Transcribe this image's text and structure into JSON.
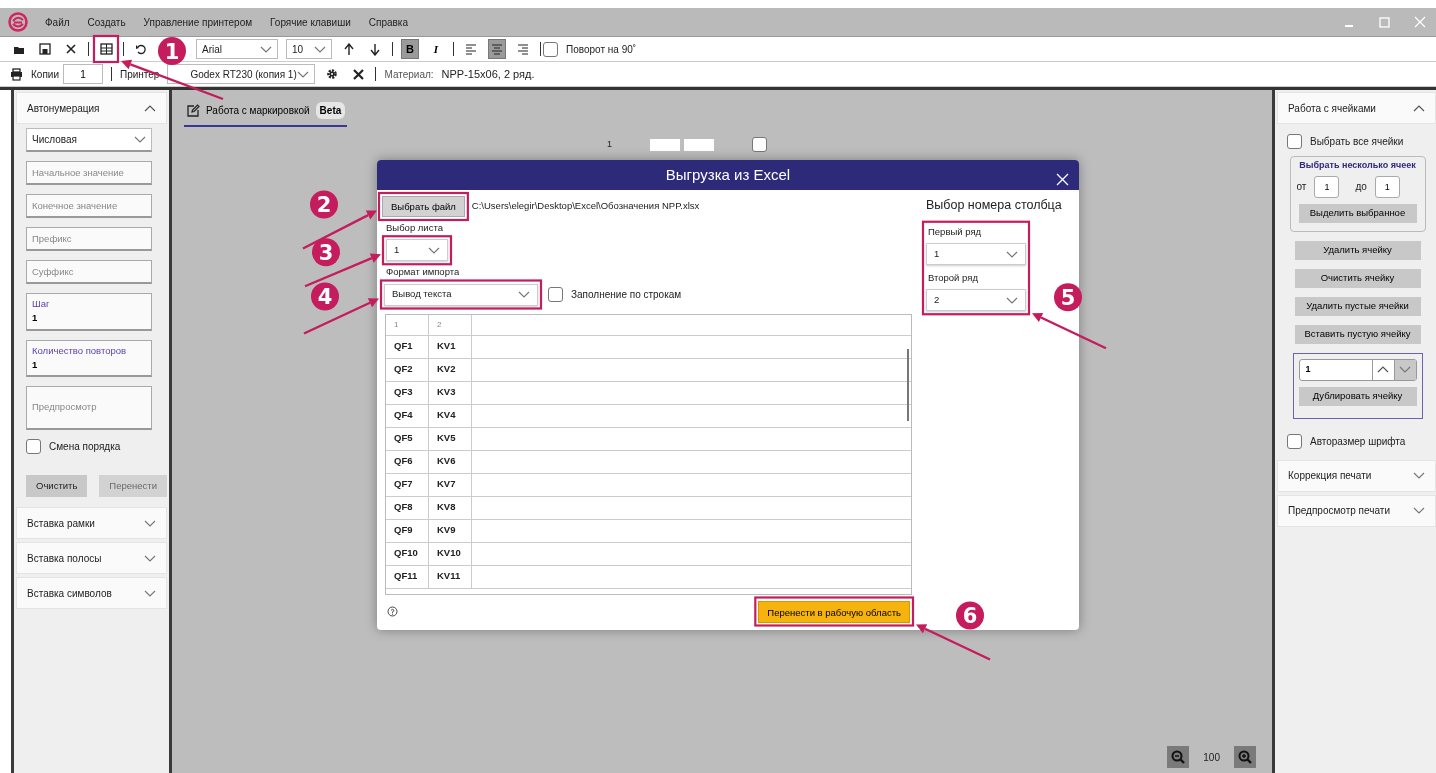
{
  "menu": [
    "Файл",
    "Создать",
    "Управление принтером",
    "Горячие клавиши",
    "Справка"
  ],
  "toolbar": {
    "font": "Arial",
    "size": "10",
    "bold": {
      "label": "B",
      "selected": true
    },
    "italic": {
      "label": "I",
      "selected": false
    },
    "align": [
      {
        "selected": false
      },
      {
        "selected": true
      },
      {
        "selected": false
      }
    ],
    "rotate": {
      "label": "Поворот на 90˚",
      "checked": false
    }
  },
  "printer_bar": {
    "copies_label": "Копии",
    "copies": "1",
    "printer_label": "Принтер",
    "printer": "Godex RT230 (копия 1)",
    "material_label": "Материал:",
    "material": "NPP-15x06, 2 ряд."
  },
  "left_panel": {
    "sections": [
      {
        "title": "Автонумерация",
        "expanded": true
      },
      {
        "title": "Вставка рамки",
        "expanded": false
      },
      {
        "title": "Вставка полосы",
        "expanded": false
      },
      {
        "title": "Вставка символов",
        "expanded": false
      }
    ],
    "type": "Числовая",
    "fields": [
      {
        "kind": "plain",
        "placeholder": "Начальное значение"
      },
      {
        "kind": "plain",
        "placeholder": "Конечное значение"
      },
      {
        "kind": "plain",
        "placeholder": "Префикс"
      },
      {
        "kind": "plain",
        "placeholder": "Суффикс"
      },
      {
        "kind": "labeled",
        "label": "Шаг",
        "value": "1"
      },
      {
        "kind": "labeled",
        "label": "Количество повторов",
        "value": "1"
      },
      {
        "kind": "area",
        "placeholder": "Предпросмотр"
      }
    ],
    "reverse": {
      "label": "Смена порядка",
      "checked": false
    },
    "buttons": [
      {
        "label": "Очистить",
        "disabled": false
      },
      {
        "label": "Перенести",
        "disabled": true
      }
    ]
  },
  "canvas": {
    "tab": {
      "label": "Работа с маркировкой",
      "badge": "Beta",
      "selected": true
    },
    "label_number": "1",
    "label_checked": false,
    "zoom": "100"
  },
  "dialog": {
    "title": "Выгрузка из Excel",
    "choose_file": "Выбрать файл",
    "path": "C:\\Users\\elegir\\Desktop\\Excel\\Обозначения NPP.xlsx",
    "sheet_label": "Выбор листа",
    "sheet": "1",
    "format_label": "Формат импорта",
    "format": "Вывод текста",
    "fill_by_rows": {
      "label": "Заполнение по строкам",
      "checked": false
    },
    "columns": [
      "1",
      "2"
    ],
    "rows": [
      [
        "QF1",
        "KV1"
      ],
      [
        "QF2",
        "KV2"
      ],
      [
        "QF3",
        "KV3"
      ],
      [
        "QF4",
        "KV4"
      ],
      [
        "QF5",
        "KV5"
      ],
      [
        "QF6",
        "KV6"
      ],
      [
        "QF7",
        "KV7"
      ],
      [
        "QF8",
        "KV8"
      ],
      [
        "QF9",
        "KV9"
      ],
      [
        "QF10",
        "KV10"
      ],
      [
        "QF11",
        "KV11"
      ]
    ],
    "column_title": "Выбор номера столбца",
    "column_selects": [
      {
        "label": "Первый ряд",
        "value": "1"
      },
      {
        "label": "Второй ряд",
        "value": "2"
      }
    ],
    "transfer": "Перенести в рабочую область"
  },
  "right_panel": {
    "sections": [
      {
        "title": "Работа с ячейками",
        "expanded": true
      },
      {
        "title": "Коррекция печати",
        "expanded": false
      },
      {
        "title": "Предпросмотр печати",
        "expanded": false
      }
    ],
    "select_all": {
      "label": "Выбрать все ячейки",
      "checked": false
    },
    "range": {
      "legend": "Выбрать несколько ячеек",
      "from_label": "от",
      "from": "1",
      "to_label": "до",
      "to": "1",
      "button": "Выделить выбранное"
    },
    "buttons": [
      "Удалить ячейку",
      "Очистить ячейку",
      "Удалить пустые ячейки",
      "Вставить пустую ячейку"
    ],
    "duplicate": {
      "value": "1",
      "button": "Дублировать ячейку"
    },
    "autosize": {
      "label": "Авторазмер шрифта",
      "checked": false
    }
  },
  "callouts": [
    {
      "number": "1"
    },
    {
      "number": "2"
    },
    {
      "number": "3"
    },
    {
      "number": "4"
    },
    {
      "number": "5"
    },
    {
      "number": "6"
    }
  ]
}
